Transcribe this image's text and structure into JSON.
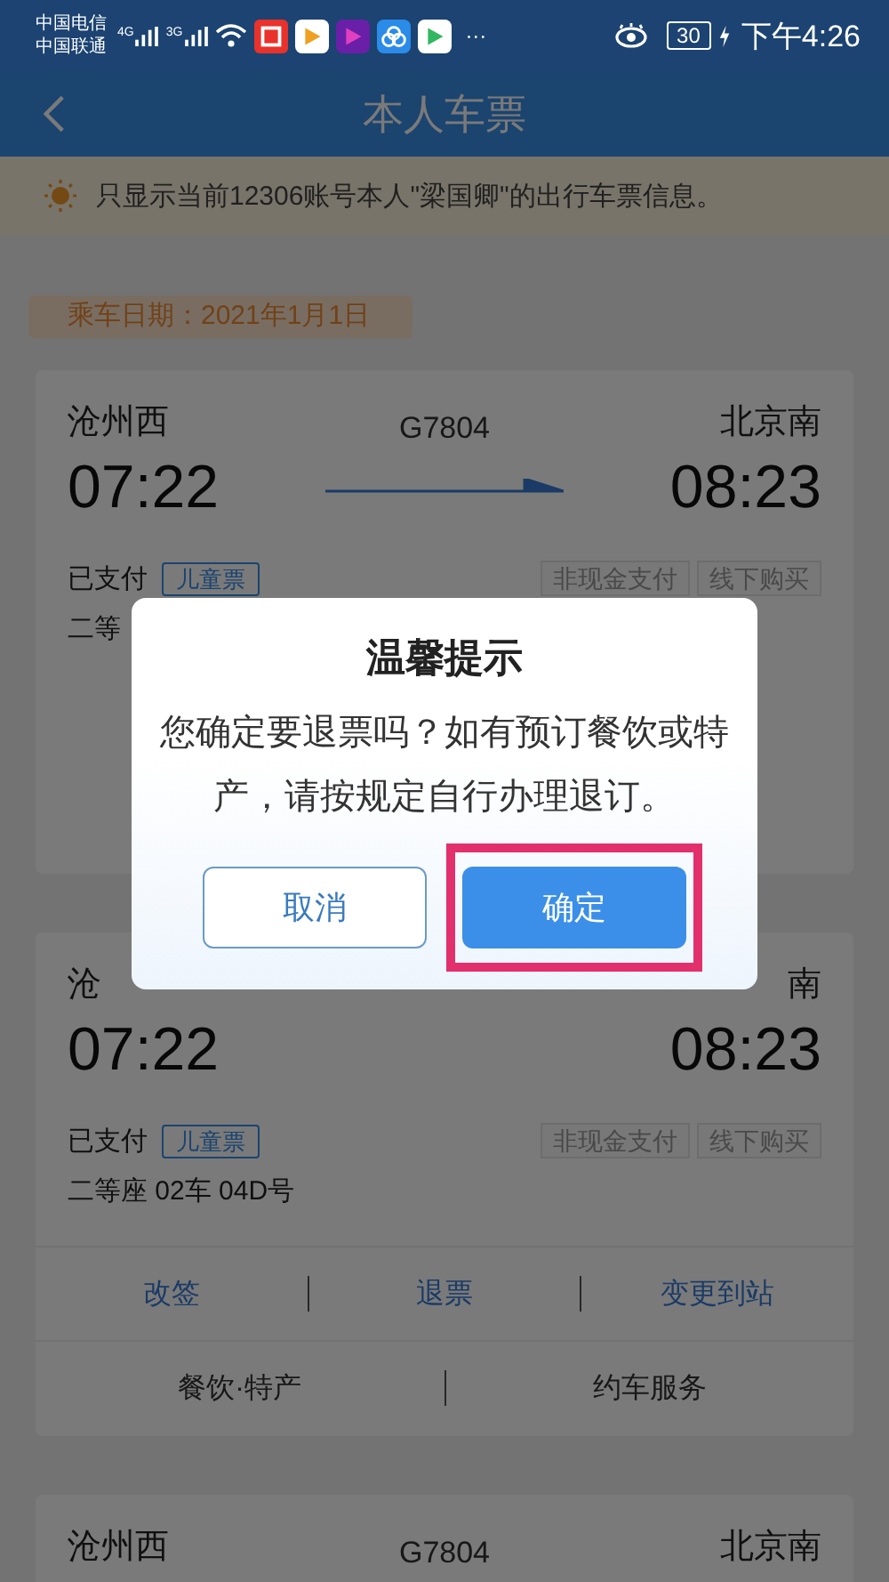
{
  "status_bar": {
    "carriers": [
      "中国电信",
      "中国联通"
    ],
    "networks": [
      "4G",
      "3G"
    ],
    "more": "···",
    "battery": "30",
    "time": "下午4:26"
  },
  "nav": {
    "title": "本人车票"
  },
  "notice": {
    "text": "只显示当前12306账号本人\"梁国卿\"的出行车票信息。"
  },
  "date_tag": "乘车日期：2021年1月1日",
  "tickets": [
    {
      "from": "沧州西",
      "to": "北京南",
      "train": "G7804",
      "depart": "07:22",
      "arrive": "08:23",
      "status": "已支付",
      "ticket_type": "儿童票",
      "tags": [
        "非现金支付",
        "线下购买"
      ],
      "seat": "二等"
    },
    {
      "from": "沧",
      "to": "南",
      "depart": "07:22",
      "arrive": "08:23",
      "status": "已支付",
      "ticket_type": "儿童票",
      "tags": [
        "非现金支付",
        "线下购买"
      ],
      "seat": "二等座 02车 04D号",
      "actions": [
        "改签",
        "退票",
        "变更到站"
      ],
      "services": [
        "餐饮·特产",
        "约车服务"
      ]
    },
    {
      "from": "沧州西",
      "to": "北京南",
      "train": "G7804"
    }
  ],
  "dialog": {
    "title": "温馨提示",
    "message": "您确定要退票吗？如有预订餐饮或特产，请按规定自行办理退订。",
    "buttons": [
      {
        "label": "取消",
        "kind": "cancel",
        "highlighted": false
      },
      {
        "label": "确定",
        "kind": "confirm",
        "highlighted": true
      }
    ]
  }
}
